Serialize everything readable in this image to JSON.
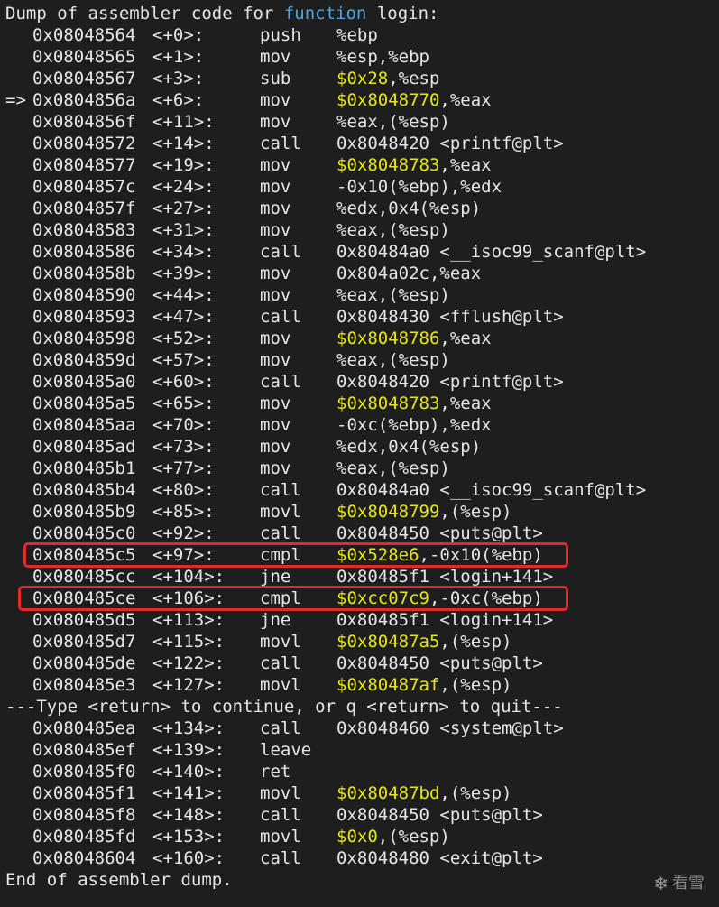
{
  "terminal": {
    "header": {
      "prefix": "Dump of assembler code for ",
      "keyword": "function",
      "suffix": " login:"
    },
    "current_marker": "=>",
    "lines": [
      {
        "addr": "0x08048564",
        "offset": "<+0>:",
        "mnem": "push",
        "ops": [
          {
            "t": "%ebp"
          }
        ]
      },
      {
        "addr": "0x08048565",
        "offset": "<+1>:",
        "mnem": "mov",
        "ops": [
          {
            "t": "%esp,%ebp"
          }
        ]
      },
      {
        "addr": "0x08048567",
        "offset": "<+3>:",
        "mnem": "sub",
        "ops": [
          {
            "t": "$0x28",
            "imm": true
          },
          {
            "t": ",%esp"
          }
        ]
      },
      {
        "addr": "0x0804856a",
        "offset": "<+6>:",
        "mnem": "mov",
        "ops": [
          {
            "t": "$0x8048770",
            "imm": true
          },
          {
            "t": ",%eax"
          }
        ],
        "current": true
      },
      {
        "addr": "0x0804856f",
        "offset": "<+11>:",
        "mnem": "mov",
        "ops": [
          {
            "t": "%eax,(%esp)"
          }
        ]
      },
      {
        "addr": "0x08048572",
        "offset": "<+14>:",
        "mnem": "call",
        "ops": [
          {
            "t": "0x8048420 <printf@plt>"
          }
        ]
      },
      {
        "addr": "0x08048577",
        "offset": "<+19>:",
        "mnem": "mov",
        "ops": [
          {
            "t": "$0x8048783",
            "imm": true
          },
          {
            "t": ",%eax"
          }
        ]
      },
      {
        "addr": "0x0804857c",
        "offset": "<+24>:",
        "mnem": "mov",
        "ops": [
          {
            "t": "-0x10(%ebp),%edx"
          }
        ]
      },
      {
        "addr": "0x0804857f",
        "offset": "<+27>:",
        "mnem": "mov",
        "ops": [
          {
            "t": "%edx,0x4(%esp)"
          }
        ]
      },
      {
        "addr": "0x08048583",
        "offset": "<+31>:",
        "mnem": "mov",
        "ops": [
          {
            "t": "%eax,(%esp)"
          }
        ]
      },
      {
        "addr": "0x08048586",
        "offset": "<+34>:",
        "mnem": "call",
        "ops": [
          {
            "t": "0x80484a0 <__isoc99_scanf@plt>"
          }
        ]
      },
      {
        "addr": "0x0804858b",
        "offset": "<+39>:",
        "mnem": "mov",
        "ops": [
          {
            "t": "0x804a02c,%eax"
          }
        ]
      },
      {
        "addr": "0x08048590",
        "offset": "<+44>:",
        "mnem": "mov",
        "ops": [
          {
            "t": "%eax,(%esp)"
          }
        ]
      },
      {
        "addr": "0x08048593",
        "offset": "<+47>:",
        "mnem": "call",
        "ops": [
          {
            "t": "0x8048430 <fflush@plt>"
          }
        ]
      },
      {
        "addr": "0x08048598",
        "offset": "<+52>:",
        "mnem": "mov",
        "ops": [
          {
            "t": "$0x8048786",
            "imm": true
          },
          {
            "t": ",%eax"
          }
        ]
      },
      {
        "addr": "0x0804859d",
        "offset": "<+57>:",
        "mnem": "mov",
        "ops": [
          {
            "t": "%eax,(%esp)"
          }
        ]
      },
      {
        "addr": "0x080485a0",
        "offset": "<+60>:",
        "mnem": "call",
        "ops": [
          {
            "t": "0x8048420 <printf@plt>"
          }
        ]
      },
      {
        "addr": "0x080485a5",
        "offset": "<+65>:",
        "mnem": "mov",
        "ops": [
          {
            "t": "$0x8048783",
            "imm": true
          },
          {
            "t": ",%eax"
          }
        ]
      },
      {
        "addr": "0x080485aa",
        "offset": "<+70>:",
        "mnem": "mov",
        "ops": [
          {
            "t": "-0xc(%ebp),%edx"
          }
        ]
      },
      {
        "addr": "0x080485ad",
        "offset": "<+73>:",
        "mnem": "mov",
        "ops": [
          {
            "t": "%edx,0x4(%esp)"
          }
        ]
      },
      {
        "addr": "0x080485b1",
        "offset": "<+77>:",
        "mnem": "mov",
        "ops": [
          {
            "t": "%eax,(%esp)"
          }
        ]
      },
      {
        "addr": "0x080485b4",
        "offset": "<+80>:",
        "mnem": "call",
        "ops": [
          {
            "t": "0x80484a0 <__isoc99_scanf@plt>"
          }
        ]
      },
      {
        "addr": "0x080485b9",
        "offset": "<+85>:",
        "mnem": "movl",
        "ops": [
          {
            "t": "$0x8048799",
            "imm": true
          },
          {
            "t": ",(%esp)"
          }
        ]
      },
      {
        "addr": "0x080485c0",
        "offset": "<+92>:",
        "mnem": "call",
        "ops": [
          {
            "t": "0x8048450 <puts@plt>"
          }
        ]
      },
      {
        "addr": "0x080485c5",
        "offset": "<+97>:",
        "mnem": "cmpl",
        "ops": [
          {
            "t": "$0x528e6",
            "imm": true
          },
          {
            "t": ",-0x10(%ebp)"
          }
        ],
        "boxed": true
      },
      {
        "addr": "0x080485cc",
        "offset": "<+104>:",
        "mnem": "jne",
        "ops": [
          {
            "t": "0x80485f1 <login+141>"
          }
        ]
      },
      {
        "addr": "0x080485ce",
        "offset": "<+106>:",
        "mnem": "cmpl",
        "ops": [
          {
            "t": "$0xcc07c9",
            "imm": true
          },
          {
            "t": ",-0xc(%ebp)"
          }
        ],
        "boxed": true
      },
      {
        "addr": "0x080485d5",
        "offset": "<+113>:",
        "mnem": "jne",
        "ops": [
          {
            "t": "0x80485f1 <login+141>"
          }
        ]
      },
      {
        "addr": "0x080485d7",
        "offset": "<+115>:",
        "mnem": "movl",
        "ops": [
          {
            "t": "$0x80487a5",
            "imm": true
          },
          {
            "t": ",(%esp)"
          }
        ]
      },
      {
        "addr": "0x080485de",
        "offset": "<+122>:",
        "mnem": "call",
        "ops": [
          {
            "t": "0x8048450 <puts@plt>"
          }
        ]
      },
      {
        "addr": "0x080485e3",
        "offset": "<+127>:",
        "mnem": "movl",
        "ops": [
          {
            "t": "$0x80487af",
            "imm": true
          },
          {
            "t": ",(%esp)"
          }
        ]
      },
      {
        "pager": "---Type <return> to continue, or q <return> to quit---"
      },
      {
        "addr": "0x080485ea",
        "offset": "<+134>:",
        "mnem": "call",
        "ops": [
          {
            "t": "0x8048460 <system@plt>"
          }
        ]
      },
      {
        "addr": "0x080485ef",
        "offset": "<+139>:",
        "mnem": "leave",
        "ops": []
      },
      {
        "addr": "0x080485f0",
        "offset": "<+140>:",
        "mnem": "ret",
        "ops": []
      },
      {
        "addr": "0x080485f1",
        "offset": "<+141>:",
        "mnem": "movl",
        "ops": [
          {
            "t": "$0x80487bd",
            "imm": true
          },
          {
            "t": ",(%esp)"
          }
        ]
      },
      {
        "addr": "0x080485f8",
        "offset": "<+148>:",
        "mnem": "call",
        "ops": [
          {
            "t": "0x8048450 <puts@plt>"
          }
        ]
      },
      {
        "addr": "0x080485fd",
        "offset": "<+153>:",
        "mnem": "movl",
        "ops": [
          {
            "t": "$0x0",
            "imm": true
          },
          {
            "t": ",(%esp)"
          }
        ]
      },
      {
        "addr": "0x08048604",
        "offset": "<+160>:",
        "mnem": "call",
        "ops": [
          {
            "t": "0x8048480 <exit@plt>"
          }
        ]
      }
    ],
    "footer": "End of assembler dump."
  },
  "watermark": {
    "icon": "snowflake-icon",
    "text": "看雪"
  },
  "colors": {
    "background": "#1e1e1e",
    "text": "#e6e6e6",
    "immediate": "#e5e51a",
    "keyword": "#4fa3e0",
    "highlight_box": "#e8262b"
  }
}
